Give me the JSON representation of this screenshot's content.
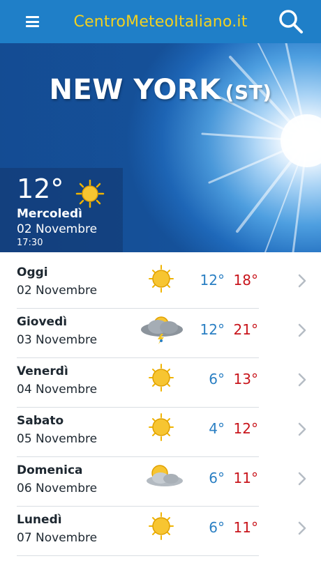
{
  "header": {
    "brand": "CentroMeteoItaliano.it",
    "menu_icon": "hamburger-menu-icon",
    "search_icon": "search-icon",
    "bg_color": "#1f7fc8",
    "brand_color": "#f3d11f"
  },
  "hero": {
    "city": "NEW YORK",
    "region": "(ST)",
    "current": {
      "temp": "12°",
      "icon": "sun-icon",
      "day": "Mercoledì",
      "date": "02 Novembre",
      "time": "17:30"
    }
  },
  "forecast": [
    {
      "day": "Oggi",
      "date": "02 Novembre",
      "icon": "sun-icon",
      "min": "12°",
      "max": "18°"
    },
    {
      "day": "Giovedì",
      "date": "03 Novembre",
      "icon": "cloud-storm-icon",
      "min": "12°",
      "max": "21°"
    },
    {
      "day": "Venerdì",
      "date": "04 Novembre",
      "icon": "sun-icon",
      "min": "6°",
      "max": "13°"
    },
    {
      "day": "Sabato",
      "date": "05 Novembre",
      "icon": "sun-icon",
      "min": "4°",
      "max": "12°"
    },
    {
      "day": "Domenica",
      "date": "06 Novembre",
      "icon": "partly-cloudy-icon",
      "min": "6°",
      "max": "11°"
    },
    {
      "day": "Lunedì",
      "date": "07 Novembre",
      "icon": "sun-icon",
      "min": "6°",
      "max": "11°"
    }
  ],
  "colors": {
    "min_temp": "#2a7fc3",
    "max_temp": "#c8141b"
  }
}
